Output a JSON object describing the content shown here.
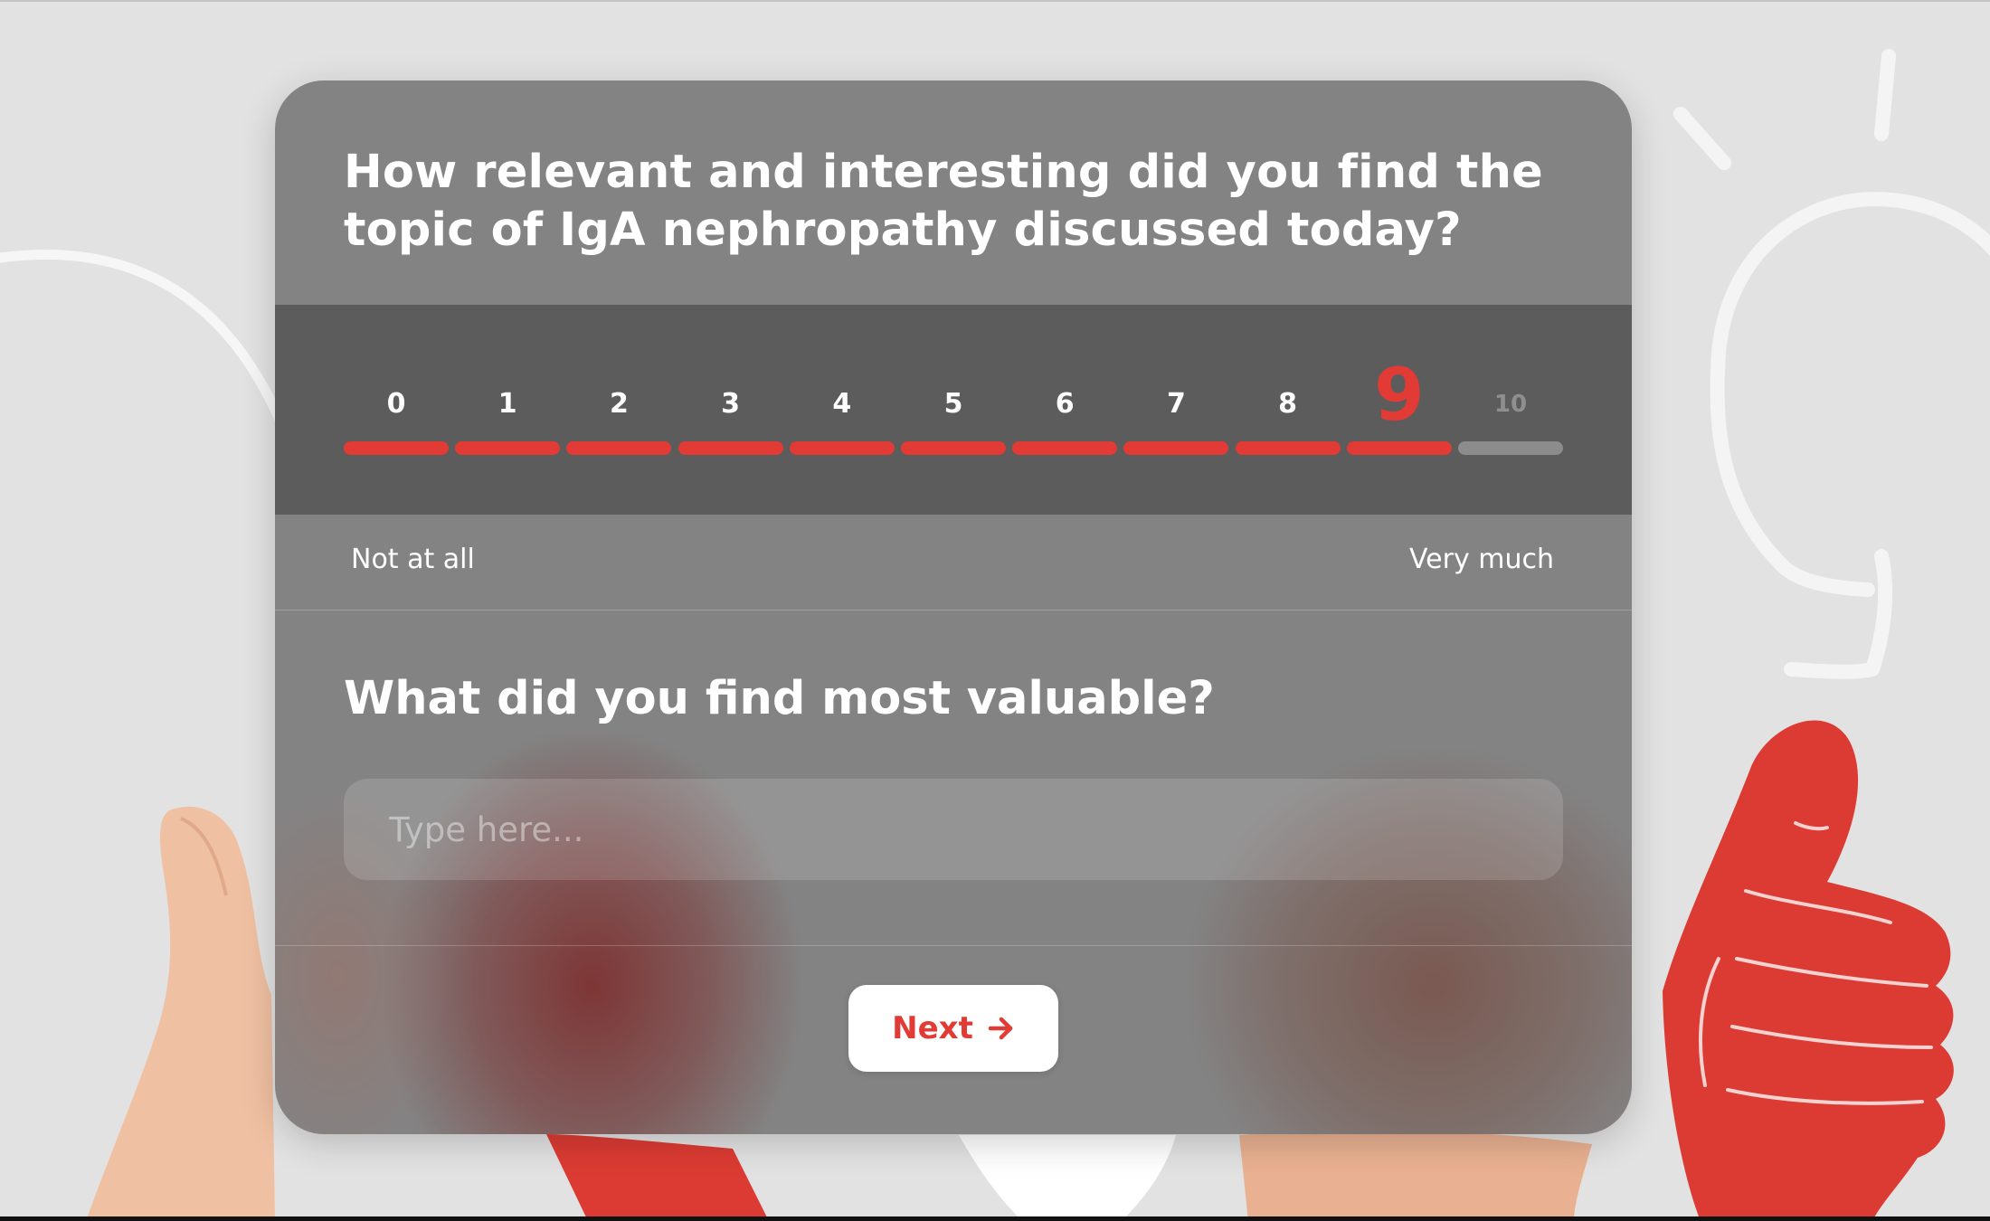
{
  "survey": {
    "question1": "How relevant and interesting did you find the topic of IgA nephropathy discussed today?",
    "scale": {
      "options": [
        "0",
        "1",
        "2",
        "3",
        "4",
        "5",
        "6",
        "7",
        "8",
        "9",
        "10"
      ],
      "selected_value": 9,
      "label_low": "Not at all",
      "label_high": "Very much"
    },
    "question2": "What did you find most valuable?",
    "answer_input": {
      "placeholder": "Type here...",
      "value": ""
    },
    "next_button": {
      "label": "Next",
      "icon": "arrow-right-icon"
    }
  },
  "background": {
    "illustrations": [
      "light-bulb-icon",
      "thumbs-up-hand-photo",
      "red-thumbs-up-hand-illustration"
    ]
  },
  "colors": {
    "accent": "#e23a35",
    "card_background": "#838383",
    "scale_band": "#5c5c5c",
    "page_background": "#e2e2e2",
    "inactive_bar": "#8c8c8c"
  }
}
